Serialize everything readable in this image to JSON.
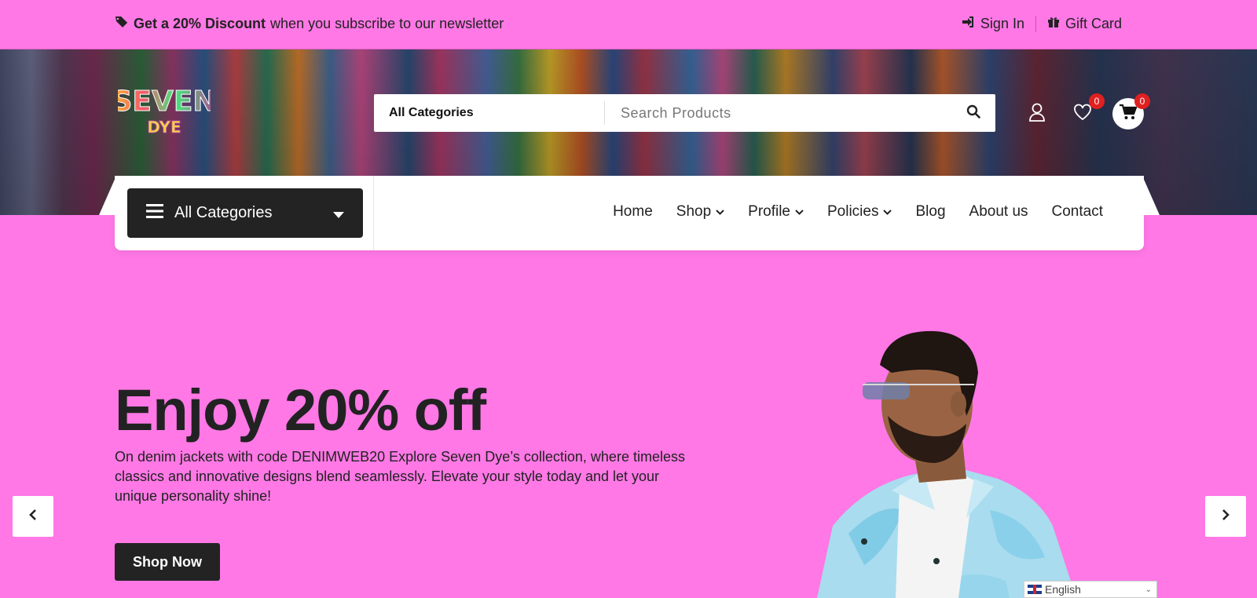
{
  "topbar": {
    "promo_bold": "Get a 20% Discount",
    "promo_rest": "when you subscribe to our newsletter",
    "sign_in": "Sign In",
    "gift_card": "Gift Card"
  },
  "header": {
    "logo_line1": "SEVEN",
    "logo_line2": "DYE",
    "search": {
      "category": "All Categories",
      "placeholder": "Search Products"
    },
    "wishlist_count": "0",
    "cart_count": "0"
  },
  "nav": {
    "all_categories": "All Categories",
    "items": [
      {
        "label": "Home"
      },
      {
        "label": "Shop"
      },
      {
        "label": "Profile"
      },
      {
        "label": "Policies"
      },
      {
        "label": "Blog"
      },
      {
        "label": "About us"
      },
      {
        "label": "Contact"
      }
    ]
  },
  "hero": {
    "title": "Enjoy 20% off",
    "text": "On denim jackets with code DENIMWEB20 Explore Seven Dye’s collection, where timeless classics and innovative designs blend seamlessly. Elevate your style today and let your unique personality shine!",
    "button": "Shop Now"
  },
  "language": "English",
  "colors": {
    "background": "#ff78e6",
    "dark": "#232323",
    "badge": "#e02020"
  }
}
